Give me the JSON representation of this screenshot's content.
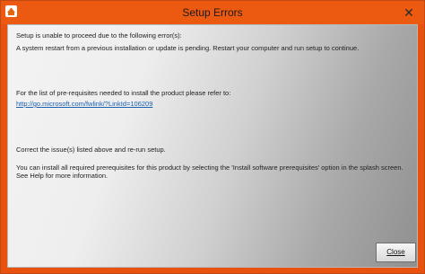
{
  "window": {
    "title": "Setup Errors",
    "close_glyph": "✕"
  },
  "content": {
    "intro": "Setup is unable to proceed due to the following error(s):",
    "error": "A system restart from a previous installation or update is pending. Restart your computer and run setup to continue.",
    "prereq_intro": "For the list of pre-requisites needed to install the product please refer to:",
    "prereq_link": "http://go.microsoft.com/fwlink/?LinkId=106209",
    "correct": "Correct the issue(s) listed above and re-run setup.",
    "install_line1": "You can install all required prerequisites for this product by selecting the 'Install software prerequisites' option in the splash screen.",
    "install_line2": "See Help for more information."
  },
  "buttons": {
    "close_label": "Close"
  },
  "colors": {
    "accent": "#ec5a12",
    "link": "#1b5fb0"
  },
  "icons": {
    "app": "setup-app-icon",
    "close": "close-icon"
  }
}
